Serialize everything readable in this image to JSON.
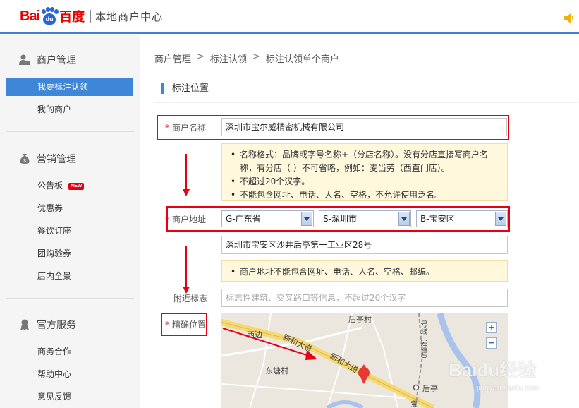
{
  "header": {
    "logo_bai": "Bai",
    "logo_du": "du",
    "logo_cn": "百度",
    "subtitle": "本地商户中心"
  },
  "sidebar": {
    "groups": [
      {
        "title": "商户管理",
        "icon": "shop-user-icon",
        "items": [
          {
            "label": "我要标注认领",
            "active": true
          },
          {
            "label": "我的商户",
            "active": false
          }
        ]
      },
      {
        "title": "营销管理",
        "icon": "money-bag-icon",
        "items": [
          {
            "label": "公告板",
            "badge": "NEW"
          },
          {
            "label": "优惠券"
          },
          {
            "label": "餐饮订座"
          },
          {
            "label": "团购验券"
          },
          {
            "label": "店内全景"
          }
        ]
      },
      {
        "title": "官方服务",
        "icon": "award-ribbon-icon",
        "items": [
          {
            "label": "商务合作"
          },
          {
            "label": "帮助中心"
          },
          {
            "label": "意见反馈"
          }
        ]
      }
    ]
  },
  "breadcrumb": {
    "items": [
      "商户管理",
      "标注认领",
      "标注认领单个商户"
    ],
    "separator": ">"
  },
  "section": {
    "title": "标注位置"
  },
  "form": {
    "required_mark": "*",
    "name": {
      "label": "商户名称",
      "value": "深圳市宝尔威精密机械有限公司",
      "tips": [
        "名称格式：品牌或字号名称+（分店名称）。没有分店直接写商户名称，有分店（ ）不可省略，例如：麦当劳（西直门店）。",
        "不超过20个汉字。",
        "不能包含网址、电话、人名、空格，不允许使用泛名。"
      ]
    },
    "address": {
      "label": "商户地址",
      "province": "G-广东省",
      "city": "S-深圳市",
      "district": "B-宝安区",
      "detail": "深圳市宝安区沙井后亭第一工业区28号",
      "tips": [
        "商户地址不能包含网址、电话、人名、空格、邮编。"
      ]
    },
    "landmark": {
      "label": "附近标志",
      "placeholder": "标志性建筑、交叉路口等信息，不超过20个汉字"
    },
    "location": {
      "label": "精确位置"
    }
  },
  "map": {
    "labels": {
      "houting_village": "后亭村",
      "xibian": "西边",
      "road": "新和大道",
      "road2": "新和大道",
      "donggang_village": "东塘村",
      "houting": "后亭",
      "highway": "号线（在建）",
      "bao": "宝"
    },
    "zoom_in": "+",
    "zoom_out": "−"
  },
  "watermark": {
    "brand": "Baidu经验",
    "url": "jingyan.baidu.com"
  },
  "colors": {
    "accent": "#3d86d8",
    "brand_red": "#e10601",
    "annotation_red": "#e60012",
    "tip_bg": "#fff8dd"
  }
}
